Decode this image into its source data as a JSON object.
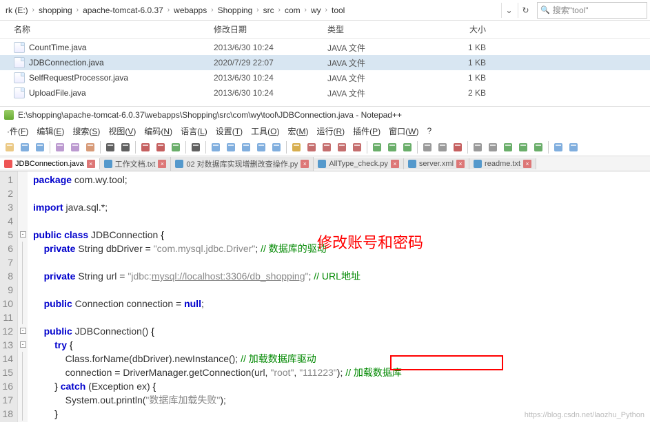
{
  "explorer": {
    "breadcrumbs": [
      "rk (E:)",
      "shopping",
      "apache-tomcat-6.0.37",
      "webapps",
      "Shopping",
      "src",
      "com",
      "wy",
      "tool"
    ],
    "refresh_icon": "refresh-icon",
    "dropdown_icon": "chevron-down-icon",
    "search_placeholder": "搜索\"tool\"",
    "columns": {
      "name": "名称",
      "date": "修改日期",
      "type": "类型",
      "size": "大小"
    },
    "files": [
      {
        "name": "CountTime.java",
        "date": "2013/6/30 10:24",
        "type": "JAVA 文件",
        "size": "1 KB",
        "selected": false
      },
      {
        "name": "JDBConnection.java",
        "date": "2020/7/29 22:07",
        "type": "JAVA 文件",
        "size": "1 KB",
        "selected": true
      },
      {
        "name": "SelfRequestProcessor.java",
        "date": "2013/6/30 10:24",
        "type": "JAVA 文件",
        "size": "1 KB",
        "selected": false
      },
      {
        "name": "UploadFile.java",
        "date": "2013/6/30 10:24",
        "type": "JAVA 文件",
        "size": "2 KB",
        "selected": false
      }
    ]
  },
  "notepadpp": {
    "title_prefix": "E:\\shopping\\apache-tomcat-6.0.37\\webapps\\Shopping\\src\\com\\wy\\tool\\JDBConnection.java - Notepad++",
    "menu": [
      "·件(F)",
      "编辑(E)",
      "搜索(S)",
      "视图(V)",
      "编码(N)",
      "语言(L)",
      "设置(T)",
      "工具(O)",
      "宏(M)",
      "运行(R)",
      "插件(P)",
      "窗口(W)",
      "?"
    ],
    "tabs": [
      {
        "label": "JDBConnection.java",
        "active": true,
        "ico": "red"
      },
      {
        "label": "工作文档.txt",
        "active": false,
        "ico": "blue"
      },
      {
        "label": "02 对数据库实现增删改查操作.py",
        "active": false,
        "ico": "blue"
      },
      {
        "label": "AllType_check.py",
        "active": false,
        "ico": "blue"
      },
      {
        "label": "server.xml",
        "active": false,
        "ico": "blue"
      },
      {
        "label": "readme.txt",
        "active": false,
        "ico": "blue"
      }
    ],
    "code": [
      {
        "n": 1,
        "html": "<span class='kw'>package</span> com.wy.tool;"
      },
      {
        "n": 2,
        "html": ""
      },
      {
        "n": 3,
        "html": "<span class='kw'>import</span> java.sql.*;"
      },
      {
        "n": 4,
        "html": ""
      },
      {
        "n": 5,
        "html": "<span class='kw'>public class</span> JDBConnection <span class='op'>{</span>",
        "fold": "open"
      },
      {
        "n": 6,
        "html": "    <span class='kw'>private</span> String dbDriver = <span class='str'>\"com.mysql.jdbc.Driver\"</span>; <span class='cmt'>// 数据库的驱动</span>"
      },
      {
        "n": 7,
        "html": ""
      },
      {
        "n": 8,
        "html": "    <span class='kw'>private</span> String url = <span class='str'>\"jdbc:<span class='und'>mysql://localhost:3306/db_shopping</span>\"</span>; <span class='cmt'>// URL地址</span>"
      },
      {
        "n": 9,
        "html": ""
      },
      {
        "n": 10,
        "html": "    <span class='kw'>public</span> Connection connection = <span class='kw'>null</span>;"
      },
      {
        "n": 11,
        "html": ""
      },
      {
        "n": 12,
        "html": "    <span class='kw'>public</span> JDBConnection() <span class='op'>{</span>",
        "fold": "open"
      },
      {
        "n": 13,
        "html": "        <span class='kw'>try</span> <span class='op'>{</span>",
        "fold": "open"
      },
      {
        "n": 14,
        "html": "            Class.forName(dbDriver).newInstance(); <span class='cmt'>// 加载数据库驱动</span>"
      },
      {
        "n": 15,
        "html": "            connection = DriverManager.getConnection(url, <span class='str'>\"root\"</span>, <span class='str'>\"111223\"</span>); <span class='cmt'>// 加载数据库</span>"
      },
      {
        "n": 16,
        "html": "        <span class='op'>}</span> <span class='kw'>catch</span> (Exception ex) <span class='op'>{</span>"
      },
      {
        "n": 17,
        "html": "            System.out.println(<span class='str'>\"数据库加载失败\"</span>);"
      },
      {
        "n": 18,
        "html": "        <span class='op'>}</span>"
      }
    ],
    "annotation": "修改账号和密码"
  },
  "watermark": "https://blog.csdn.net/laozhu_Python",
  "toolbar_colors": [
    "#e8c070",
    "#6aa0d8",
    "#6aa0d8",
    "#b088c8",
    "#b088c8",
    "#d08860",
    "#444",
    "#444",
    "#bb4444",
    "#bb4444",
    "#50a050",
    "#444",
    "#6aa0d8",
    "#6aa0d8",
    "#6aa0d8",
    "#6aa0d8",
    "#6aa0d8",
    "#d0a030",
    "#bb5555",
    "#bb5555",
    "#bb5555",
    "#bb5555",
    "#50a050",
    "#50a050",
    "#50a050",
    "#888",
    "#888",
    "#bb4444",
    "#888",
    "#888",
    "#50a050",
    "#50a050",
    "#50a050",
    "#6aa0d8",
    "#6aa0d8"
  ]
}
